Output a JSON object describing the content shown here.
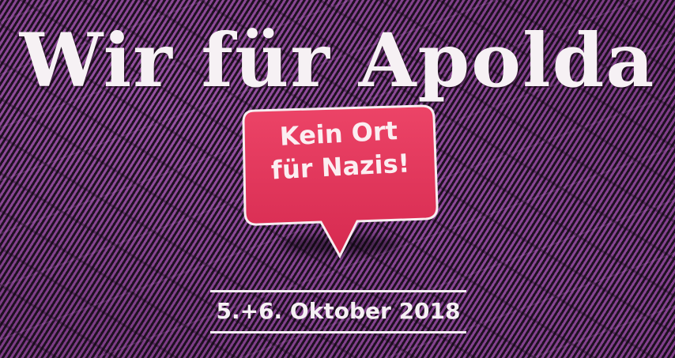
{
  "headline": "Wir für Apolda",
  "bubble": {
    "line1": "Kein Ort",
    "line2": "für Nazis!"
  },
  "date": "5.+6. Oktober 2018",
  "colors": {
    "background": "#7d3d86",
    "stripes": "#160c18",
    "bubble": "#e8335a",
    "text": "#f6f1f4"
  }
}
